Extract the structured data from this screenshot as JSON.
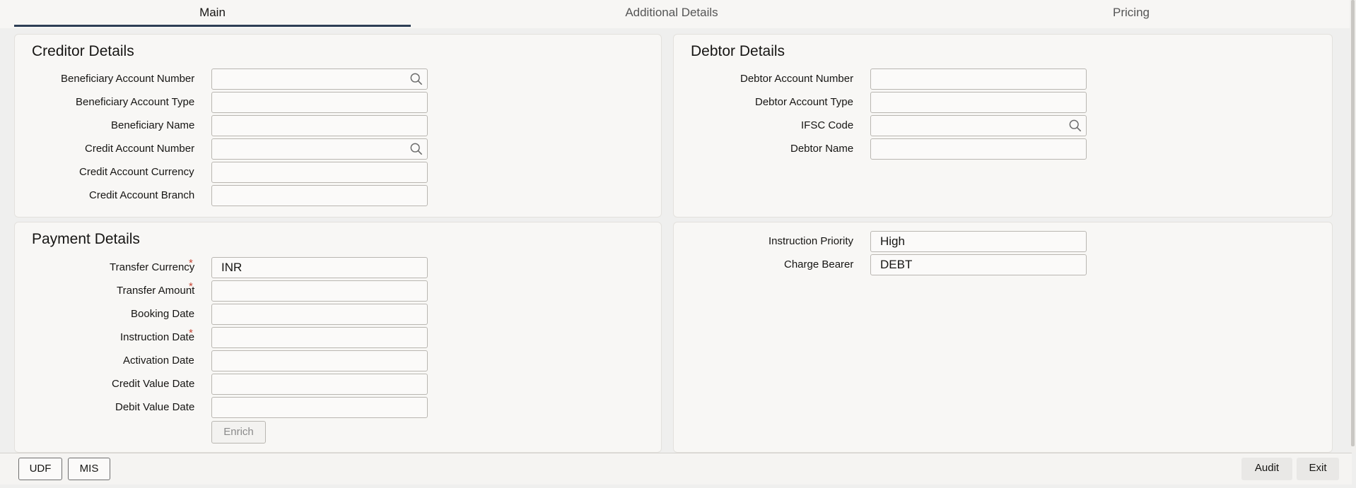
{
  "tabs": [
    {
      "label": "Main"
    },
    {
      "label": "Additional Details"
    },
    {
      "label": "Pricing"
    }
  ],
  "creditor": {
    "title": "Creditor Details",
    "fields": [
      {
        "label": "Beneficiary Account Number",
        "value": "",
        "search": true
      },
      {
        "label": "Beneficiary Account Type",
        "value": ""
      },
      {
        "label": "Beneficiary Name",
        "value": ""
      },
      {
        "label": "Credit Account Number",
        "value": "",
        "search": true
      },
      {
        "label": "Credit Account Currency",
        "value": ""
      },
      {
        "label": "Credit Account Branch",
        "value": ""
      }
    ]
  },
  "debtor": {
    "title": "Debtor Details",
    "fields": [
      {
        "label": "Debtor Account Number",
        "value": ""
      },
      {
        "label": "Debtor Account Type",
        "value": ""
      },
      {
        "label": "IFSC Code",
        "value": "",
        "search": true
      },
      {
        "label": "Debtor Name",
        "value": ""
      }
    ]
  },
  "payment": {
    "title": "Payment Details",
    "fields": [
      {
        "label": "Transfer Currency",
        "value": "INR",
        "required": true
      },
      {
        "label": "Transfer Amount",
        "value": "",
        "required": true
      },
      {
        "label": "Booking Date",
        "value": ""
      },
      {
        "label": "Instruction Date",
        "value": "",
        "required": true
      },
      {
        "label": "Activation Date",
        "value": ""
      },
      {
        "label": "Credit Value Date",
        "value": ""
      },
      {
        "label": "Debit Value Date",
        "value": ""
      }
    ],
    "enrich_label": "Enrich"
  },
  "instruction": {
    "fields": [
      {
        "label": "Instruction Priority",
        "value": "High"
      },
      {
        "label": "Charge Bearer",
        "value": "DEBT"
      }
    ]
  },
  "footer": {
    "udf_label": "UDF",
    "mis_label": "MIS",
    "audit_label": "Audit",
    "exit_label": "Exit"
  },
  "required_marker": "*"
}
